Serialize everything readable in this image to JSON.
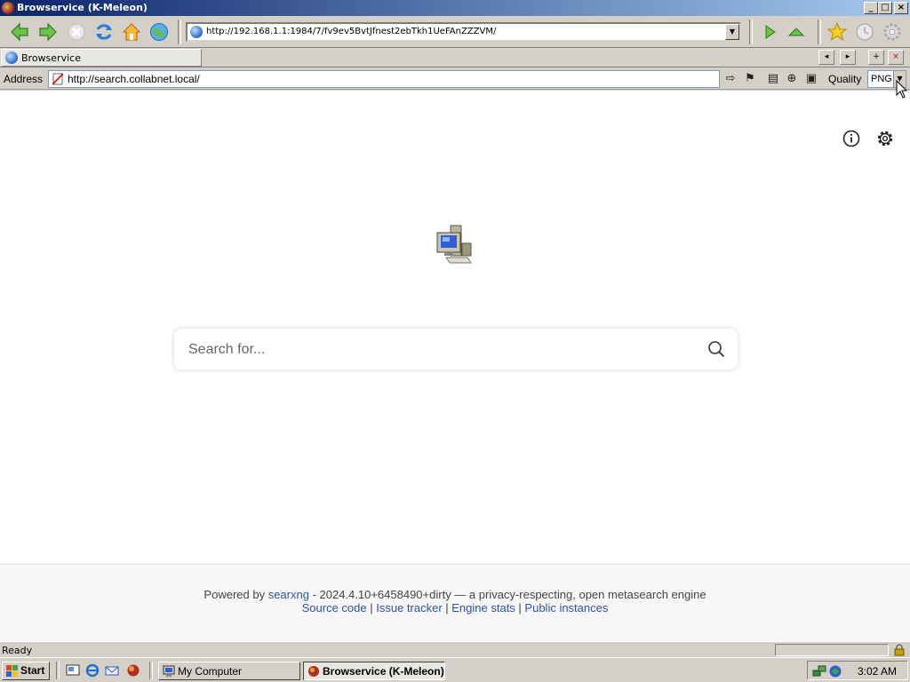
{
  "window": {
    "title": "Browservice (K-Meleon)",
    "controls": {
      "minimize": "_",
      "maximize": "□",
      "close": "×"
    }
  },
  "navbar": {
    "url": "http://192.168.1.1:1984/7/fv9ev5BvtJfnest2ebTkh1UeFAnZZZVM/",
    "icons": [
      "back-arrow-icon",
      "forward-arrow-icon",
      "stop-icon",
      "reload-icon",
      "home-icon",
      "globe-icon",
      "go-icon",
      "up-icon",
      "bookmark-star-icon",
      "history-clock-icon",
      "settings-gear-icon"
    ]
  },
  "tabs": [
    {
      "label": "Browservice"
    }
  ],
  "address_row": {
    "label": "Address",
    "url": "http://search.collabnet.local/",
    "quality_label": "Quality",
    "quality_value": "PNG"
  },
  "page": {
    "search_placeholder": "Search for...",
    "footer": {
      "powered_by": "Powered by",
      "engine_link": "searxng",
      "version_text": " - 2024.4.10+6458490+dirty — a privacy-respecting, open metasearch engine",
      "links": [
        "Source code",
        "Issue tracker",
        "Engine stats",
        "Public instances"
      ],
      "separator": " | "
    }
  },
  "status": {
    "text": "Ready"
  },
  "taskbar": {
    "start_label": "Start",
    "items": [
      {
        "label": "My Computer",
        "active": false
      },
      {
        "label": "Browservice (K-Meleon)",
        "active": true
      }
    ],
    "clock": "3:02 AM"
  },
  "colors": {
    "titlebar_start": "#0a246a",
    "titlebar_end": "#a6caf0",
    "link": "#3050a0",
    "chrome": "#d4d0c8"
  }
}
